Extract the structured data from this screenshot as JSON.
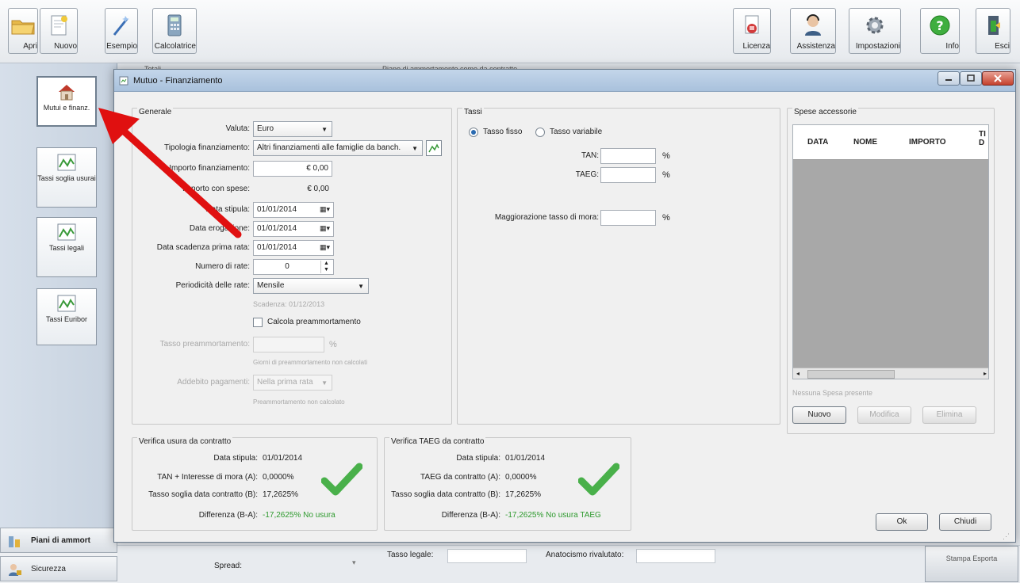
{
  "toolbar": {
    "left": [
      {
        "label": "Apri",
        "icon": "folder-open-icon"
      },
      {
        "label": "Nuovo",
        "icon": "new-document-icon"
      },
      {
        "label": "Esempio",
        "icon": "magic-wand-icon"
      },
      {
        "label": "Calcolatrice",
        "icon": "calculator-icon"
      }
    ],
    "right": [
      {
        "label": "Licenza",
        "icon": "license-icon"
      },
      {
        "label": "Assistenza",
        "icon": "support-agent-icon"
      },
      {
        "label": "Impostazioni",
        "icon": "settings-gear-icon"
      },
      {
        "label": "Info",
        "icon": "help-info-icon"
      },
      {
        "label": "Esci",
        "icon": "exit-door-icon"
      }
    ]
  },
  "sidebar": {
    "items": [
      {
        "label": "Mutui e finanz.",
        "icon": "house-icon"
      },
      {
        "label": "Tassi soglia usurai",
        "icon": "chart-icon"
      },
      {
        "label": "Tassi legali",
        "icon": "chart-icon"
      },
      {
        "label": "Tassi Euribor",
        "icon": "chart-icon"
      }
    ],
    "nav": [
      {
        "label": "Piani di ammort",
        "icon": "piani-icon"
      },
      {
        "label": "Sicurezza",
        "icon": "security-icon"
      }
    ]
  },
  "background": {
    "totali": "Totali",
    "piano_label": "Piano di ammortamento come da contratto",
    "spread_label": "Spread:",
    "tasso_legale_label": "Tasso legale:",
    "anatocismo_label": "Anatocismo rivalutato:",
    "stampa_button": "Stampa Esporta"
  },
  "dialog": {
    "title": "Mutuo - Finanziamento",
    "generale": {
      "title": "Generale",
      "valuta_label": "Valuta:",
      "valuta_value": "Euro",
      "tipologia_label": "Tipologia finanziamento:",
      "tipologia_value": "Altri finanziamenti alle famiglie da banch.",
      "importo_label": "Importo finanziamento:",
      "importo_value": "€ 0,00",
      "importo_spese_label": "Importo con spese:",
      "importo_spese_value": "€ 0,00",
      "data_stipula_label": "Data stipula:",
      "data_stipula_value": "01/01/2014",
      "data_erogazione_label": "Data erogazione:",
      "data_erogazione_value": "01/01/2014",
      "data_scadenza_label": "Data scadenza prima rata:",
      "data_scadenza_value": "01/01/2014",
      "numero_rate_label": "Numero di rate:",
      "numero_rate_value": "0",
      "periodicita_label": "Periodicità delle rate:",
      "periodicita_value": "Mensile",
      "scadenza_text": "Scadenza: 01/12/2013",
      "calcola_label": "Calcola preammortamento",
      "tasso_pre_label": "Tasso preammortamento:",
      "percent": "%",
      "giorni_text": "Giorni di preammortamento non calcolati",
      "addebito_label": "Addebito pagamenti:",
      "addebito_value": "Nella prima rata",
      "preamm_text": "Preammortamento non calcolato"
    },
    "tassi": {
      "title": "Tassi",
      "fisso_label": "Tasso fisso",
      "variabile_label": "Tasso variabile",
      "tan_label": "TAN:",
      "taeg_label": "TAEG:",
      "percent": "%",
      "magg_label": "Maggiorazione tasso di mora:"
    },
    "spese": {
      "title": "Spese accessorie",
      "columns": [
        "DATA",
        "NOME",
        "IMPORTO",
        "TI D"
      ],
      "empty_text": "Nessuna Spesa presente",
      "nuovo": "Nuovo",
      "modifica": "Modifica",
      "elimina": "Elimina"
    },
    "usura": {
      "title": "Verifica usura da contratto",
      "stipula_label": "Data stipula:",
      "stipula_value": "01/01/2014",
      "tan_label": "TAN + Interesse di mora (A):",
      "tan_value": "0,0000%",
      "soglia_label": "Tasso soglia data contratto (B):",
      "soglia_value": "17,2625%",
      "diff_label": "Differenza (B-A):",
      "diff_value": "-17,2625% No usura"
    },
    "taeg_check": {
      "title": "Verifica TAEG da contratto",
      "stipula_label": "Data stipula:",
      "stipula_value": "01/01/2014",
      "taeg_label": "TAEG da contratto (A):",
      "taeg_value": "0,0000%",
      "soglia_label": "Tasso soglia data contratto (B):",
      "soglia_value": "17,2625%",
      "diff_label": "Differenza (B-A):",
      "diff_value": "-17,2625% No usura TAEG"
    },
    "ok": "Ok",
    "chiudi": "Chiudi"
  },
  "colors": {
    "accent_green": "#2e9a2e",
    "arrow_red": "#e01010"
  }
}
